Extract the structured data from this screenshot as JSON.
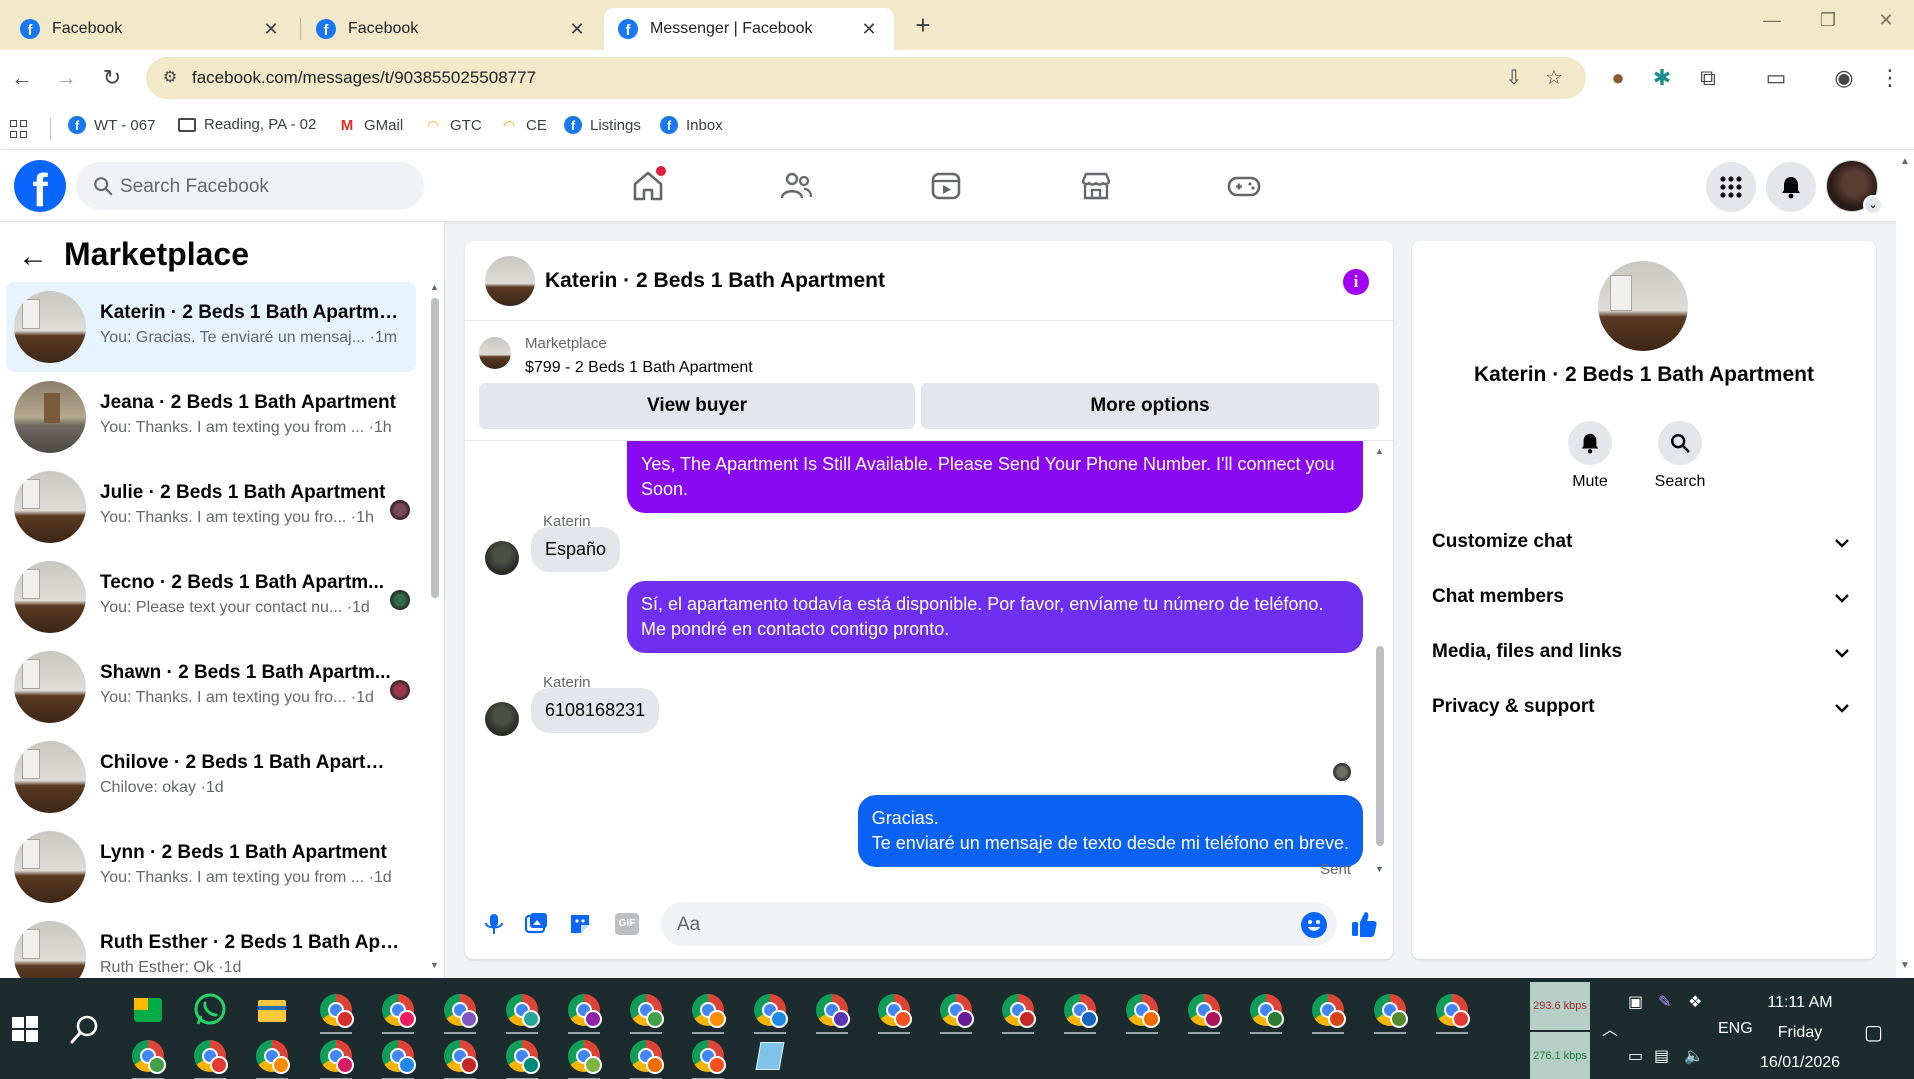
{
  "browser": {
    "tabs": [
      {
        "title": "Facebook",
        "active": false
      },
      {
        "title": "Facebook",
        "active": false
      },
      {
        "title": "Messenger | Facebook",
        "active": true
      }
    ],
    "url": "facebook.com/messages/t/903855025508777",
    "bookmarks": [
      {
        "label": "WT - 067",
        "icon": "facebook-icon"
      },
      {
        "label": "Reading, PA - 02",
        "icon": "folder-icon"
      },
      {
        "label": "GMail",
        "icon": "gmail-icon"
      },
      {
        "label": "GTC",
        "icon": "rainbow-icon"
      },
      {
        "label": "CE",
        "icon": "rainbow-icon"
      },
      {
        "label": "Listings",
        "icon": "facebook-icon"
      },
      {
        "label": "Inbox",
        "icon": "facebook-icon"
      }
    ]
  },
  "fb": {
    "search_placeholder": "Search Facebook",
    "accent": "#0866ff"
  },
  "left": {
    "title": "Marketplace",
    "chats": [
      {
        "name": "Katerin · 2 Beds 1 Bath Apartment",
        "preview": "You: Gracias. Te enviaré un mensaj... ·1m",
        "active": true,
        "seen": false
      },
      {
        "name": "Jeana · 2 Beds 1 Bath Apartment",
        "preview": "You: Thanks. I am texting you from ... ·1h",
        "active": false,
        "seen": false
      },
      {
        "name": "Julie · 2 Beds 1 Bath Apartment",
        "preview": "You: Thanks. I am texting you fro... ·1h",
        "active": false,
        "seen": true
      },
      {
        "name": "Tecno · 2 Beds 1 Bath Apartm...",
        "preview": "You: Please text your contact nu... ·1d",
        "active": false,
        "seen": true
      },
      {
        "name": "Shawn · 2 Beds 1 Bath Apartm...",
        "preview": "You: Thanks. I am texting you fro... ·1d",
        "active": false,
        "seen": true
      },
      {
        "name": "Chilove · 2 Beds 1 Bath Apartment",
        "preview": "Chilove: okay ·1d",
        "active": false,
        "seen": false
      },
      {
        "name": "Lynn · 2 Beds 1 Bath Apartment",
        "preview": "You: Thanks. I am texting you from ... ·1d",
        "active": false,
        "seen": false
      },
      {
        "name": "Ruth Esther · 2 Beds 1 Bath Apar...",
        "preview": "Ruth Esther: Ok ·1d",
        "active": false,
        "seen": false
      }
    ]
  },
  "conversation": {
    "title": "Katerin · 2 Beds 1 Bath Apartment",
    "marketplace_label": "Marketplace",
    "listing": "$799 - 2 Beds 1 Bath Apartment",
    "view_buyer": "View buyer",
    "more_options": "More options",
    "messages": {
      "out1": "Yes, The Apartment Is Still Available. Please Send Your Phone Number. I'll connect you Soon.",
      "sender1": "Katerin",
      "in1": "Españo",
      "out2": "Sí, el apartamento todavía está disponible. Por favor, envíame tu número de teléfono. Me pondré en contacto contigo pronto.",
      "sender2": "Katerin",
      "in2": "6108168231",
      "out3_line1": "Gracias.",
      "out3_line2": "Te enviaré un mensaje de texto desde mi teléfono en breve."
    },
    "status": "Sent",
    "composer_placeholder": "Aa",
    "gif_label": "GIF",
    "colors": {
      "purple_bubble": "#8a09f3",
      "violet_bubble": "#6e2ff0",
      "blue_bubble": "#0a62f5"
    }
  },
  "info": {
    "title": "Katerin · 2 Beds 1 Bath Apartment",
    "mute": "Mute",
    "search": "Search",
    "sections": [
      "Customize chat",
      "Chat members",
      "Media, files and links",
      "Privacy & support"
    ]
  },
  "taskbar": {
    "net_up": "293.6 kbps",
    "net_down": "276.1 kbps",
    "lang": "ENG",
    "time": "11:11 AM",
    "day": "Friday",
    "date": "16/01/2026"
  }
}
